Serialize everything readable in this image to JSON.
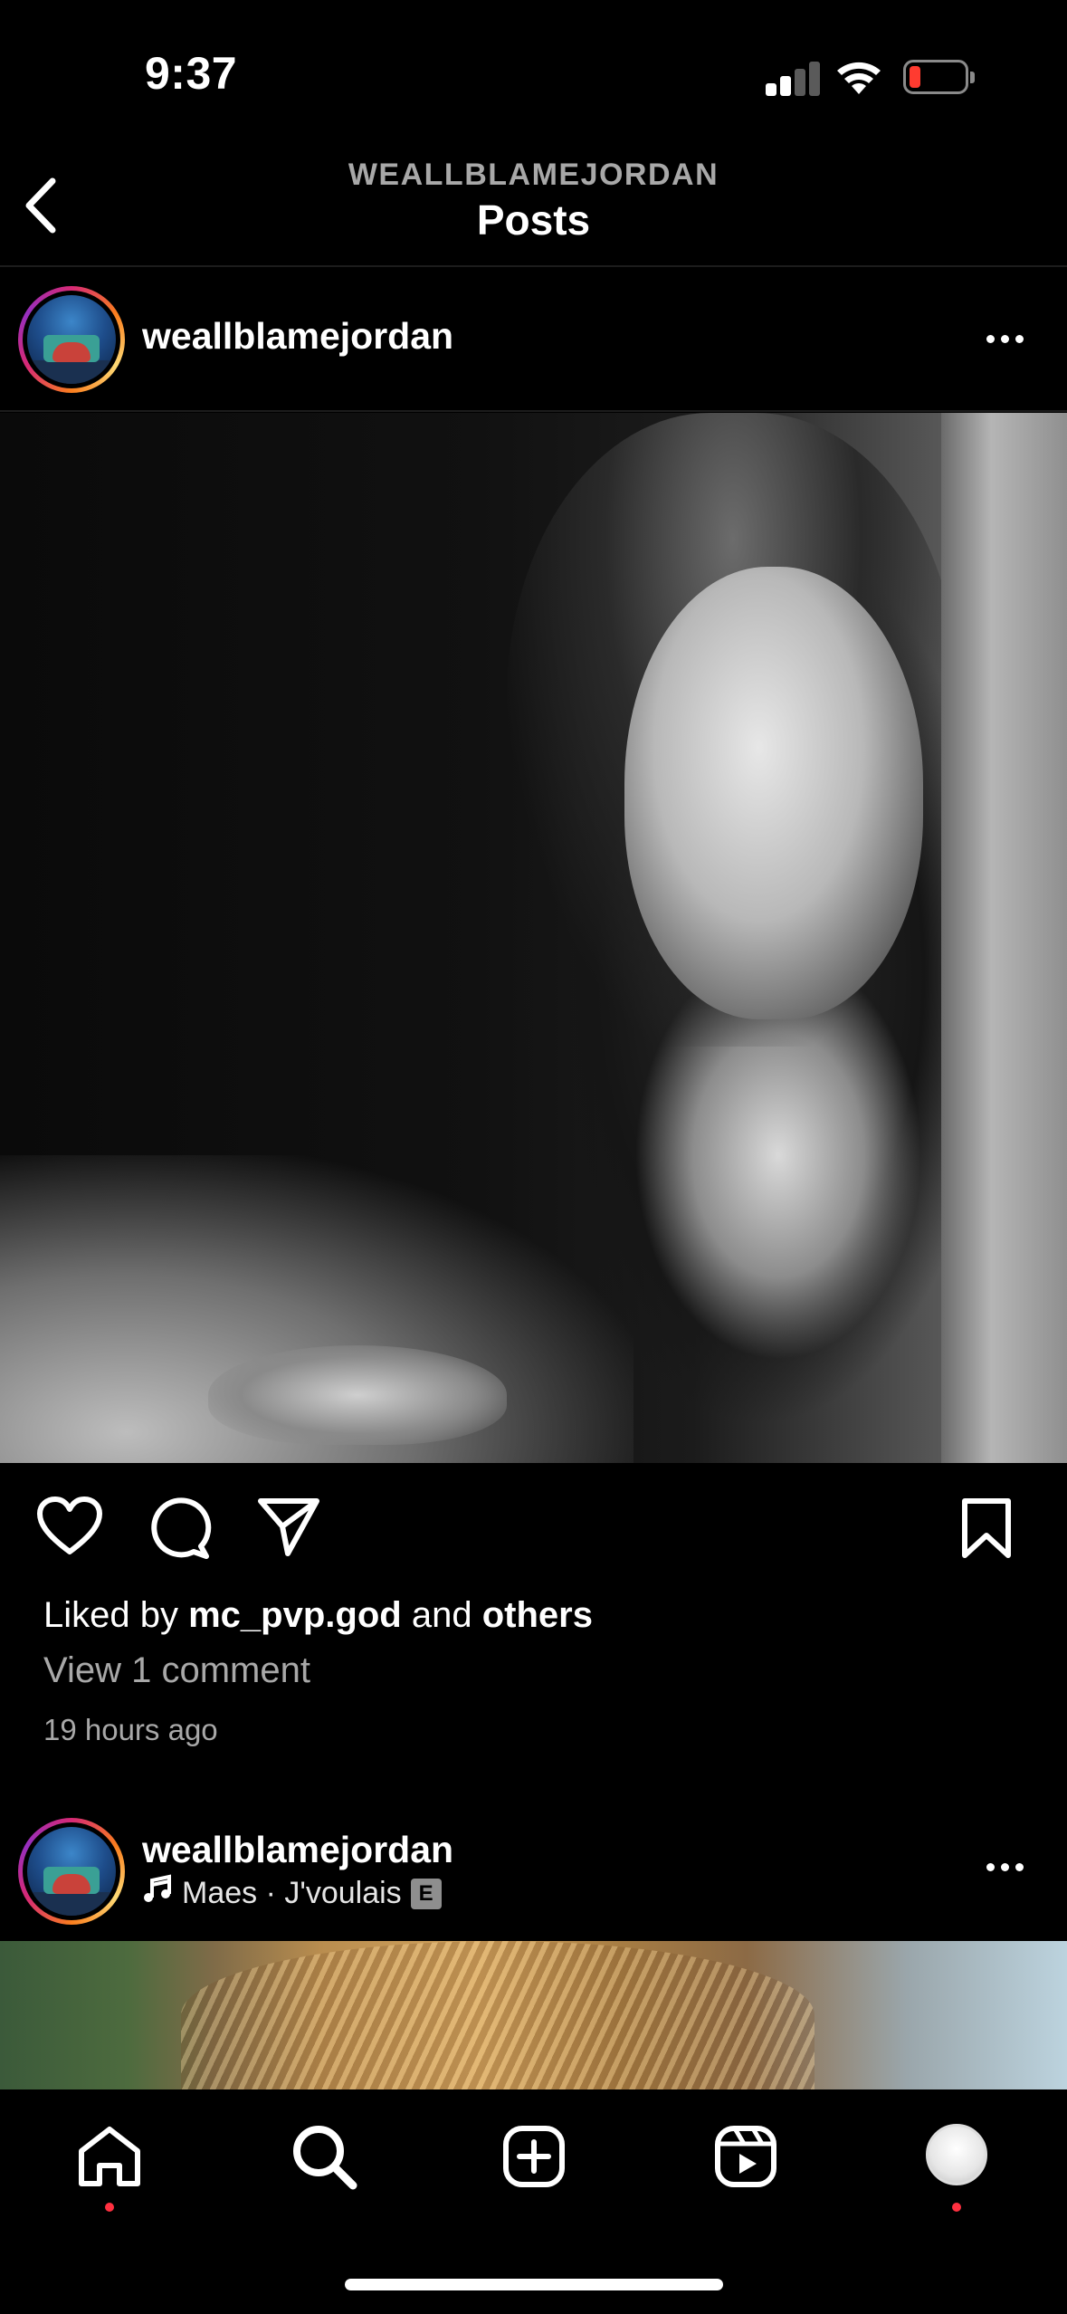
{
  "status_bar": {
    "time": "9:37"
  },
  "header": {
    "account": "WEALLBLAMEJORDAN",
    "title": "Posts"
  },
  "posts": [
    {
      "username": "weallblamejordan",
      "liked_by_prefix": "Liked by",
      "liked_by_user": "mc_pvp.god",
      "liked_by_and": "and",
      "liked_by_others": "others",
      "view_comments": "View 1 comment",
      "time_ago": "19 hours ago"
    },
    {
      "username": "weallblamejordan",
      "music": "Maes · J'voulais",
      "explicit_badge": "E"
    }
  ],
  "tab_bar": {
    "items": [
      "home-icon",
      "search-icon",
      "create-icon",
      "reels-icon",
      "profile-avatar"
    ]
  },
  "colors": {
    "background": "#000000",
    "secondary_text": "#a8a8a8",
    "notification_dot": "#ff3040",
    "battery_low": "#ff3b30"
  }
}
